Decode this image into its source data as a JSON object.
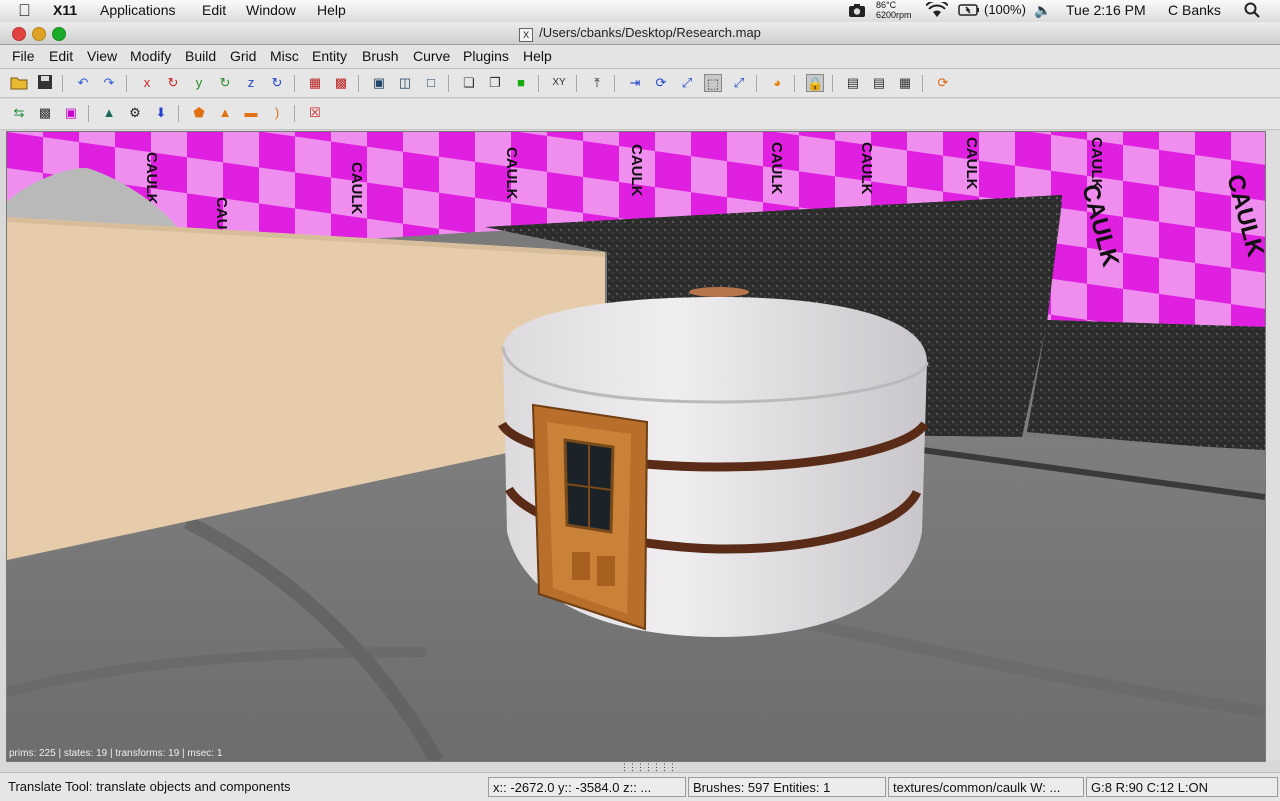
{
  "mac_menubar": {
    "app_name": "X11",
    "menus": [
      "Applications",
      "Edit",
      "Window",
      "Help"
    ],
    "temp": "86°C",
    "rpm": "6200rpm",
    "battery": "(100%)",
    "clock": "Tue 2:16 PM",
    "user": "C Banks"
  },
  "window": {
    "title": "/Users/cbanks/Desktop/Research.map",
    "x_badge": "X"
  },
  "app_menu": [
    "File",
    "Edit",
    "View",
    "Modify",
    "Build",
    "Grid",
    "Misc",
    "Entity",
    "Brush",
    "Curve",
    "Plugins",
    "Help"
  ],
  "viewport": {
    "stats": "prims: 225 | states: 19 | transforms: 19 | msec: 1",
    "texture_word": "CAULK"
  },
  "statusbar": {
    "tool_hint": "Translate Tool: translate objects and components",
    "coords": "x:: -2672.0  y:: -3584.0  z:: ...",
    "counts": "Brushes: 597 Entities: 1",
    "texture": "textures/common/caulk W: ...",
    "grid": "G:8  R:90  C:12  L:ON"
  },
  "colors": {
    "caulk_magenta": "#e020e0",
    "caulk_pink": "#f089f0",
    "floor": "#7b7b7b",
    "tan_wall": "#e9ceaa"
  }
}
